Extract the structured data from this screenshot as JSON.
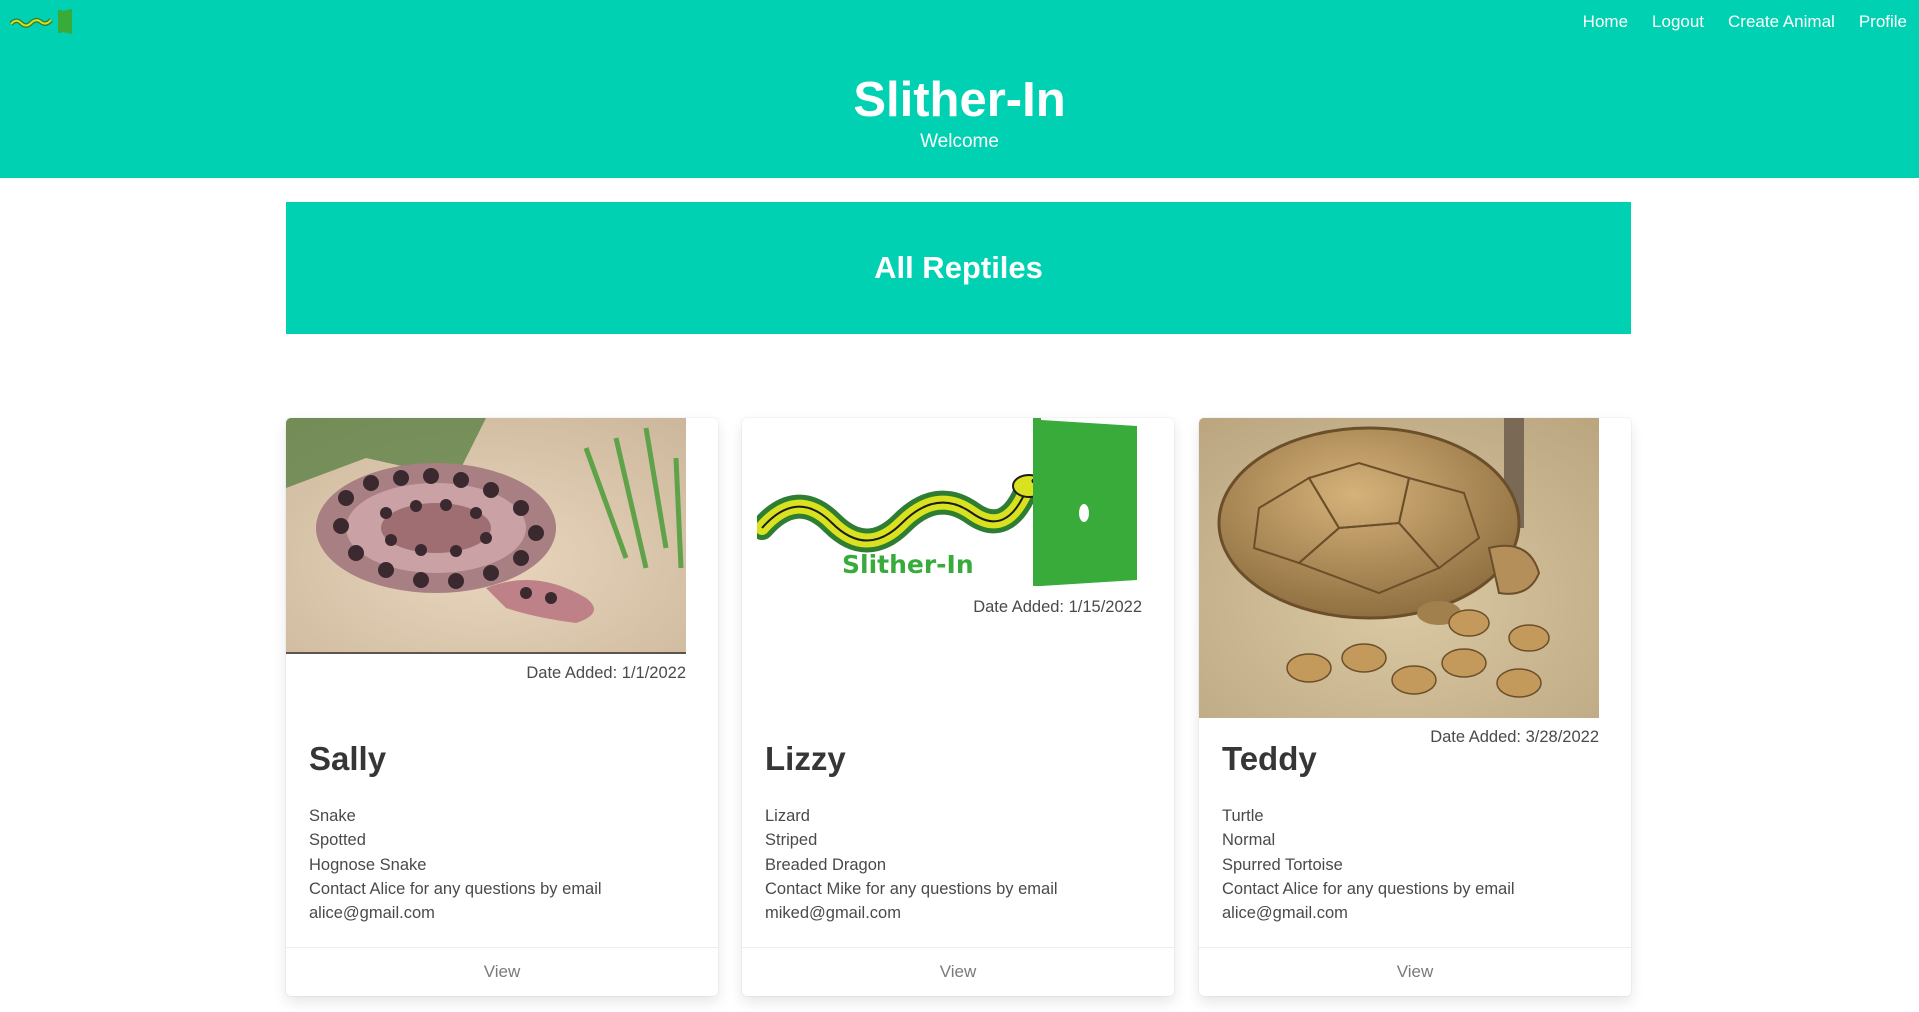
{
  "header": {
    "logo": "slither-in-logo",
    "title": "Slither-In",
    "subtitle": "Welcome",
    "nav": [
      "Home",
      "Logout",
      "Create Animal",
      "Profile"
    ],
    "background": "#00d1b2"
  },
  "section": {
    "title": "All Reptiles"
  },
  "cards": [
    {
      "name": "Sally",
      "date_added": "Date Added: 1/1/2022",
      "type": "Snake",
      "pattern": "Spotted",
      "species": "Hognose Snake",
      "contact": "Contact Alice for any questions by email",
      "email": "alice@gmail.com",
      "view_label": "View",
      "image": "hognose-snake-photo"
    },
    {
      "name": "Lizzy",
      "date_added": "Date Added: 1/15/2022",
      "type": "Lizard",
      "pattern": "Striped",
      "species": "Breaded Dragon",
      "contact": "Contact Mike for any questions by email",
      "email": "miked@gmail.com",
      "view_label": "View",
      "image": "slither-in-logo",
      "logo_text": "Slither-In"
    },
    {
      "name": "Teddy",
      "date_added": "Date Added: 3/28/2022",
      "type": "Turtle",
      "pattern": "Normal",
      "species": "Spurred Tortoise",
      "contact": "Contact Alice for any questions by email",
      "email": "alice@gmail.com",
      "view_label": "View",
      "image": "spurred-tortoise-photo"
    }
  ]
}
